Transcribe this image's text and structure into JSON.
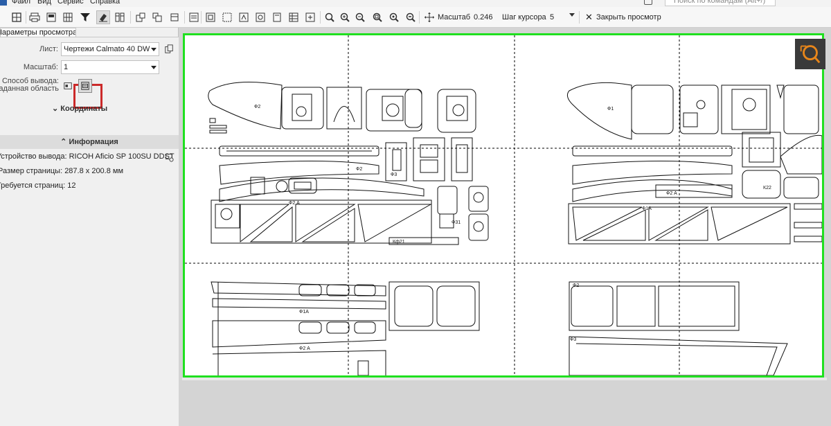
{
  "menu": {
    "items": [
      "Файл",
      "Вид",
      "Сервис",
      "Справка"
    ],
    "search_placeholder": "Поиск по командам (Alt+/)"
  },
  "toolbar": {
    "icons": [
      "grid-icon",
      "print-icon",
      "view-icon",
      "filter-icon",
      "eraser-icon",
      "columns-icon",
      "layout-icon",
      "layout2-icon",
      "text-icon",
      "zoom-icon",
      "zoom-in-icon",
      "zoom-out-icon",
      "zoom-window-icon",
      "zoom-fit-icon",
      "zoom-minus-icon",
      "pan-icon"
    ],
    "scale_label": "Масштаб",
    "scale_value": "0.246",
    "step_label": "Шаг курсора",
    "step_value": "5",
    "close_label": "Закрыть просмотр"
  },
  "panel": {
    "tab_title": "Параметры просмотра",
    "sheet_label": "Лист:",
    "sheet_value": "Чертежи Calmato 40 DW",
    "scale_label": "Масштаб:",
    "scale_value": "1",
    "output_label_1": "Способ вывода:",
    "output_label_2": "Заданная область",
    "coords_label": "Координаты",
    "info_title": "Информация",
    "device_label": "Устройство вывода:",
    "device_value": "RICOH Aficio SP 100SU DDST",
    "page_size_label": "Размер страницы:",
    "page_size_value": "287.8 x 200.8 мм",
    "pages_label": "Требуется страниц:",
    "pages_value": "12"
  },
  "drawing_labels": [
    "Ф2",
    "Ф2",
    "Ф3",
    "Ф2 А",
    "Ф1А",
    "Ф2 А",
    "Ф3",
    "Ф2",
    "Ф1",
    "Ф1А",
    "К22",
    "Кф21",
    "Ф31",
    "Ф2 А"
  ]
}
